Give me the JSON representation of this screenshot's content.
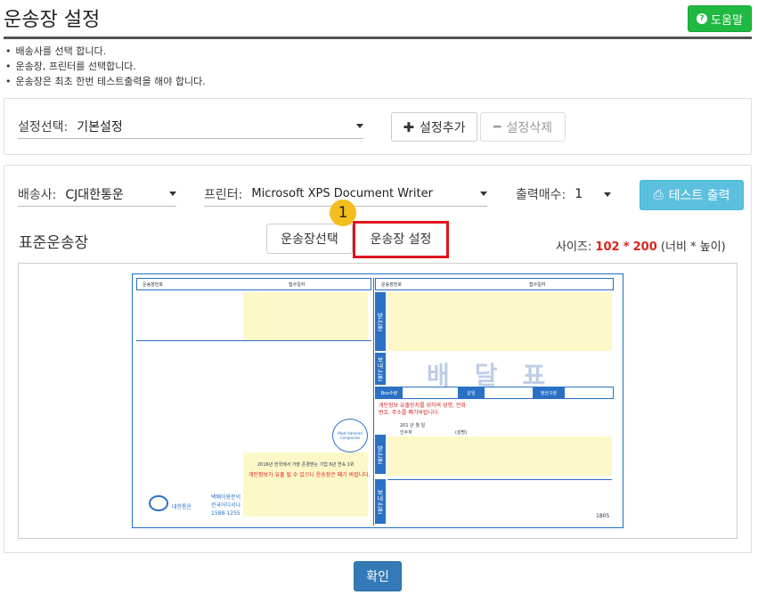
{
  "header": {
    "title": "운송장 설정",
    "help_label": "도움말",
    "help_icon": "question-circle-icon"
  },
  "notes": [
    "배송사를 선택 합니다.",
    "운송장, 프린터를 선택합니다.",
    "운송장은 최초 한번 테스트출력을 해야 합니다."
  ],
  "settings_panel": {
    "select_label": "설정선택:",
    "select_value": "기본설정",
    "add_label": "설정추가",
    "delete_label": "설정삭제"
  },
  "print_panel": {
    "carrier_label": "배송사:",
    "carrier_value": "CJ대한통운",
    "printer_label": "프린터:",
    "printer_value": "Microsoft XPS Document Writer",
    "copies_label": "출력매수:",
    "copies_value": "1",
    "test_print_label": "테스트 출력",
    "section_title": "표준운송장",
    "tab_select": "운송장선택",
    "tab_setting": "운송장 설정",
    "marker_number": "1",
    "size_label": "사이즈:",
    "size_width": "102",
    "size_sep": "*",
    "size_height": "200",
    "size_unit": "(너비 * 높이)"
  },
  "label": {
    "waybill_no": "운송장번호",
    "receive_date": "접수일자",
    "sender": "받는분",
    "content_label": "보내는분",
    "delivery_text": "배달표",
    "box_qty": "Box수량",
    "fare": "운임",
    "settle_type": "정산구분",
    "privacy_note": "개인정보 유출방지를 위하여 성명, 전화번호, 주소를 폐기바랍니다.",
    "receiver_label": "받는분",
    "sender_label2": "보내는분",
    "award_text": "2016년 한국에서 가장 존경받는 기업 6년 연속 1위",
    "privacy_note2": "개인정보가 유출 될 수 있으니 운송장은 폐기 바랍니다.",
    "brand": "대한통운",
    "contact1": "택배이용문의",
    "contact2": "전국어디서나",
    "phone": "1588-1255",
    "code": "1805",
    "seal_text": "Most Admired Companies",
    "date_text": "201   년   월   일",
    "signer": "인수자",
    "sign": "(성명)"
  },
  "footer": {
    "confirm_label": "확인"
  }
}
